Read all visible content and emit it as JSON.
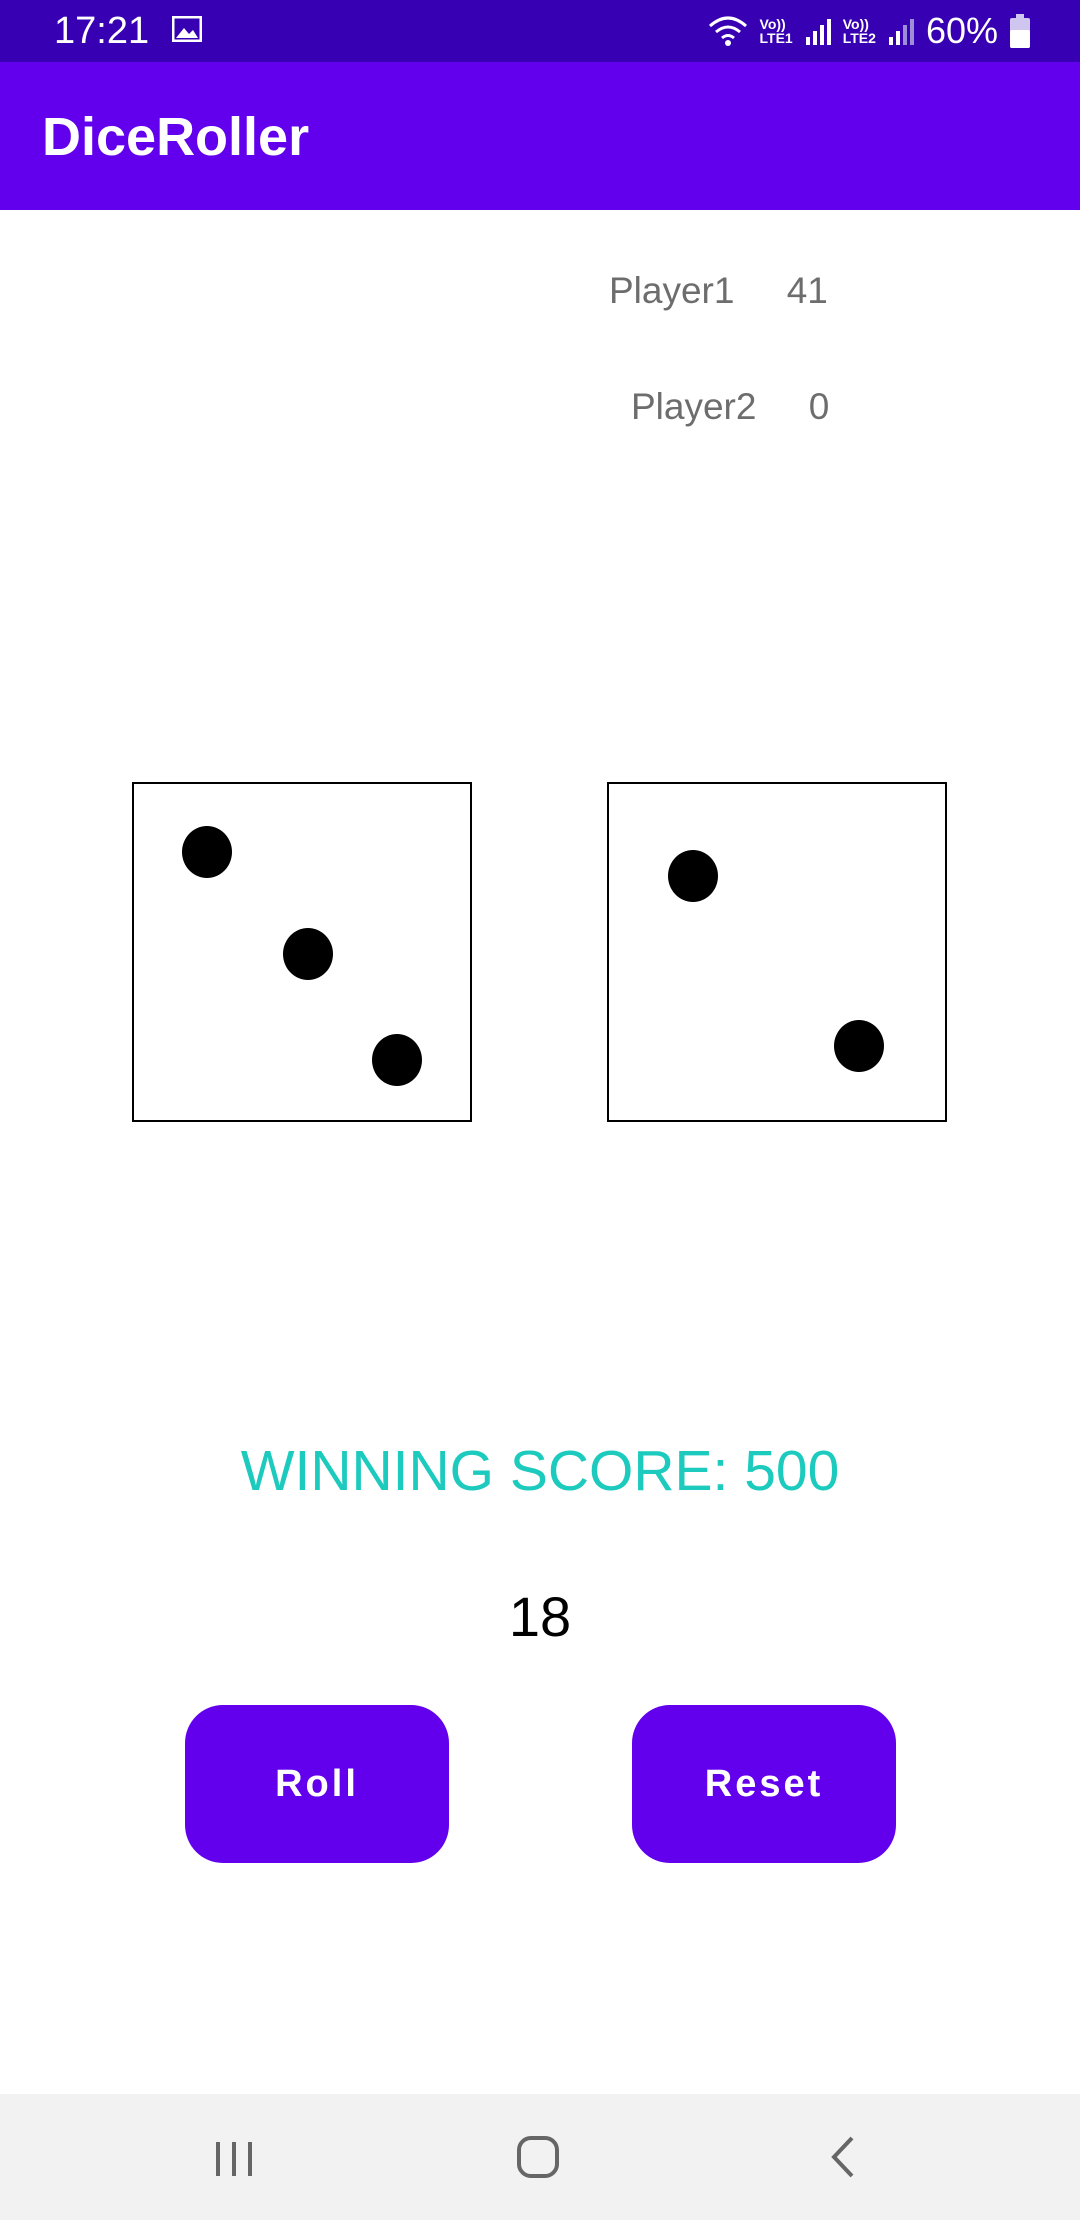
{
  "status_bar": {
    "time": "17:21",
    "lte1": "Vo))\nLTE1",
    "lte2": "Vo))\nLTE2",
    "battery": "60%",
    "icons": [
      "image-icon",
      "wifi-icon",
      "signal-icon",
      "signal-icon",
      "battery-icon"
    ]
  },
  "app_bar": {
    "title": "DiceRoller"
  },
  "scores": {
    "player1_label": "Player1",
    "player1_value": "41",
    "player2_label": "Player2",
    "player2_value": "0"
  },
  "dice": [
    {
      "value": 3
    },
    {
      "value": 2
    }
  ],
  "winning_score_text": "WINNING SCORE: 500",
  "current_total": "18",
  "buttons": {
    "roll": "Roll",
    "reset": "Reset"
  },
  "nav": {
    "icons": [
      "recents-icon",
      "home-icon",
      "back-icon"
    ]
  },
  "colors": {
    "status_bar": "#3700b3",
    "app_bar": "#6200ee",
    "button": "#6200ee",
    "winning_text": "#1ccbbd",
    "score_text": "#6d6d6d"
  }
}
